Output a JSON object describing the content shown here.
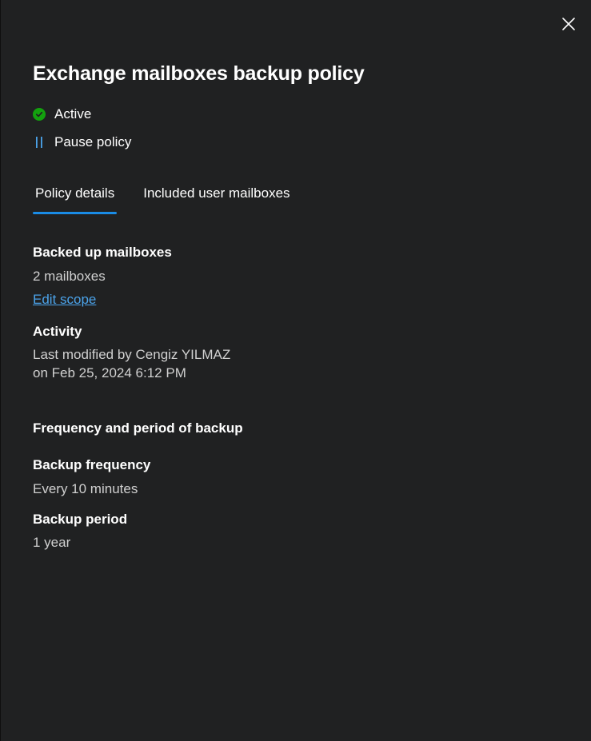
{
  "panel": {
    "title": "Exchange mailboxes backup policy",
    "close_icon": "close-icon"
  },
  "status": {
    "icon": "checkmark-circle-icon",
    "label": "Active",
    "color": "#13a10e"
  },
  "pause": {
    "icon": "pause-icon",
    "label": "Pause policy",
    "color": "#4ba3ea"
  },
  "tabs": [
    {
      "label": "Policy details",
      "selected": true
    },
    {
      "label": "Included user mailboxes",
      "selected": false
    }
  ],
  "details": {
    "backed_up_mailboxes": {
      "label": "Backed up mailboxes",
      "value": "2 mailboxes",
      "link": "Edit scope"
    },
    "activity": {
      "label": "Activity",
      "line1": "Last modified by Cengiz YILMAZ",
      "line2": "on Feb 25, 2024 6:12 PM"
    },
    "frequency_section": {
      "heading": "Frequency and period of backup"
    },
    "backup_frequency": {
      "label": "Backup frequency",
      "value": "Every 10 minutes"
    },
    "backup_period": {
      "label": "Backup period",
      "value": "1 year"
    }
  },
  "colors": {
    "background": "#202122",
    "accent": "#1a8ce6",
    "link": "#4ba3ea"
  }
}
